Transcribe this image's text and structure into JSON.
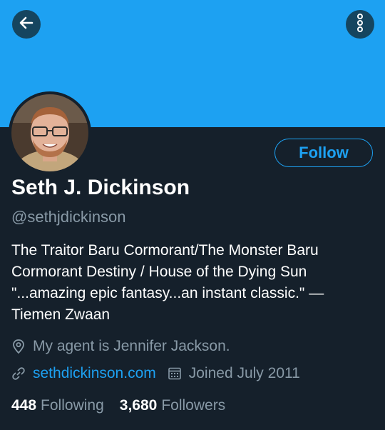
{
  "profile": {
    "name": "Seth J. Dickinson",
    "handle": "@sethjdickinson",
    "bio_lines": [
      "The Traitor Baru Cormorant/The Monster Baru",
      "Cormorant Destiny / House of the Dying Sun",
      "\"...amazing epic fantasy...an instant classic.\" —",
      "Tiemen Zwaan"
    ],
    "location": "My agent is Jennifer Jackson.",
    "website": "sethdickinson.com",
    "joined": "Joined July 2011",
    "following_count": "448",
    "following_label": "Following",
    "followers_count": "3,680",
    "followers_label": "Followers"
  },
  "actions": {
    "follow_label": "Follow"
  },
  "icons": {
    "back": "arrow-left-icon",
    "more": "more-vertical-icon",
    "location": "location-pin-icon",
    "link": "link-icon",
    "calendar": "calendar-icon"
  },
  "colors": {
    "banner": "#1da1f2",
    "background": "#15202b",
    "accent": "#1da1f2",
    "secondary_text": "#8899a6"
  }
}
